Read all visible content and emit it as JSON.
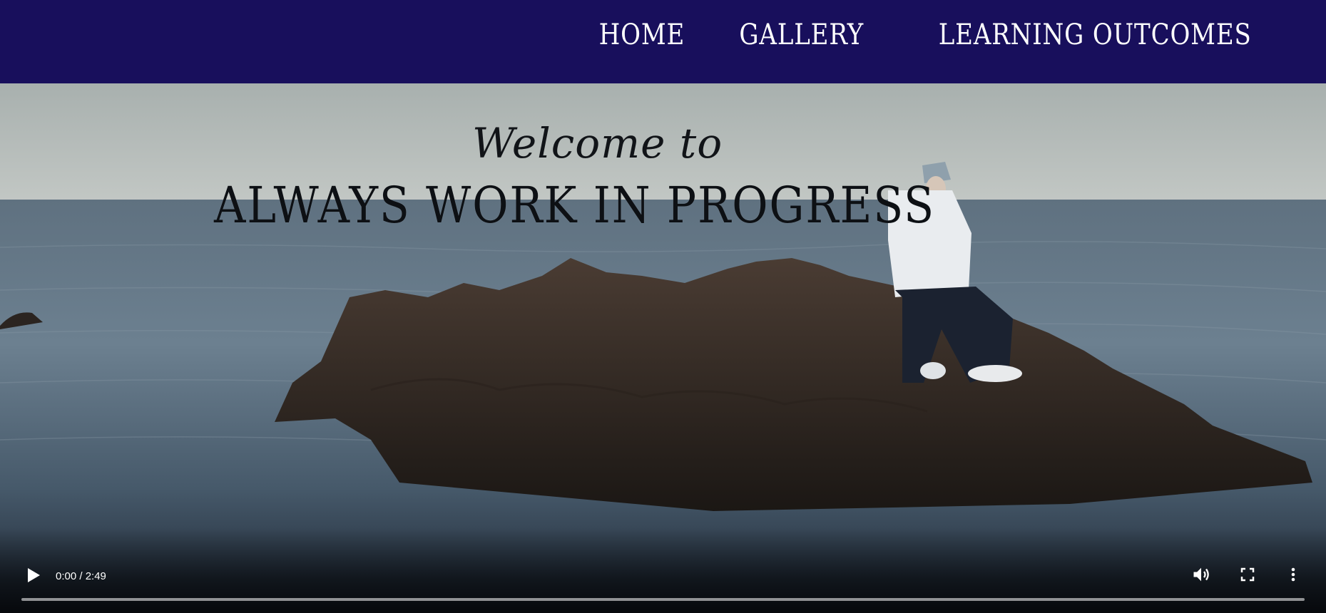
{
  "nav": {
    "links": [
      {
        "label": "HOME"
      },
      {
        "label": "GALLERY"
      },
      {
        "label": "LEARNING OUTCOMES"
      }
    ],
    "background": "#180f5c",
    "text_color": "#ffffff"
  },
  "hero": {
    "welcome": "Welcome to",
    "title": "ALWAYS WORK IN PROGRESS"
  },
  "video": {
    "time": "0:00 / 2:49",
    "progress": 0,
    "icons": {
      "play": "play-icon",
      "volume": "volume-icon",
      "fullscreen": "fullscreen-icon",
      "more": "more-vertical-icon"
    }
  }
}
